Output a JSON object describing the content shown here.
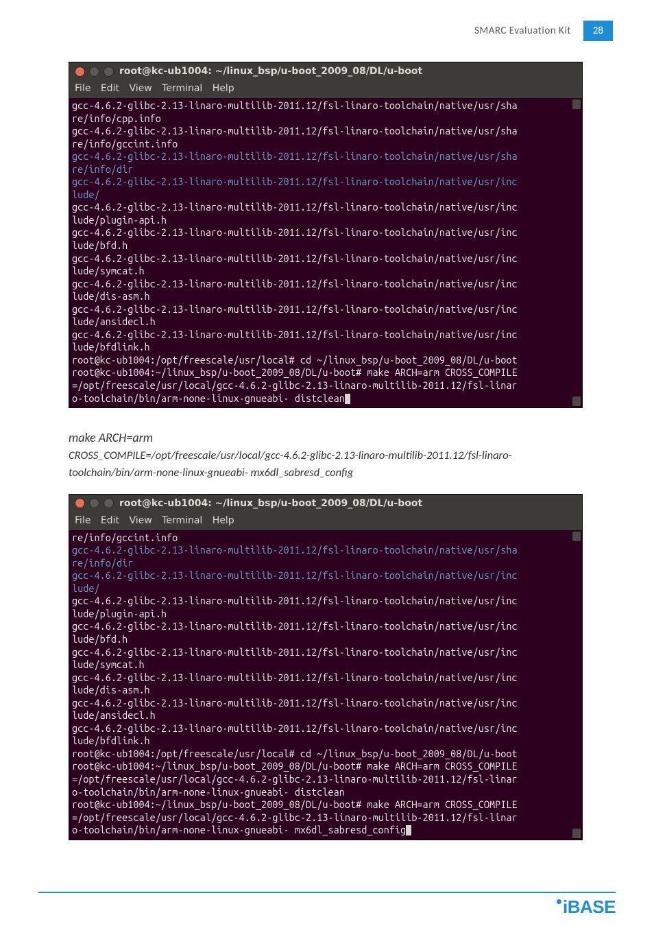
{
  "header": {
    "title": "SMARC Evaluation Kit",
    "page": "28"
  },
  "footer": {
    "logo": "iBASE"
  },
  "term_title": "root@kc-ub1004: ~/linux_bsp/u-boot_2009_08/DL/u-boot",
  "menubar": [
    "File",
    "Edit",
    "View",
    "Terminal",
    "Help"
  ],
  "term1": {
    "lines": [
      {
        "c": "w",
        "t": "gcc-4.6.2-glibc-2.13-linaro-multilib-2011.12/fsl-linaro-toolchain/native/usr/share/info/cpp.info"
      },
      {
        "c": "w",
        "t": "gcc-4.6.2-glibc-2.13-linaro-multilib-2011.12/fsl-linaro-toolchain/native/usr/share/info/gccint.info"
      },
      {
        "c": "b",
        "t": "gcc-4.6.2-glibc-2.13-linaro-multilib-2011.12/fsl-linaro-toolchain/native/usr/share/info/dir"
      },
      {
        "c": "b",
        "t": "gcc-4.6.2-glibc-2.13-linaro-multilib-2011.12/fsl-linaro-toolchain/native/usr/include/"
      },
      {
        "c": "w",
        "t": "gcc-4.6.2-glibc-2.13-linaro-multilib-2011.12/fsl-linaro-toolchain/native/usr/include/plugin-api.h"
      },
      {
        "c": "w",
        "t": "gcc-4.6.2-glibc-2.13-linaro-multilib-2011.12/fsl-linaro-toolchain/native/usr/include/bfd.h"
      },
      {
        "c": "w",
        "t": "gcc-4.6.2-glibc-2.13-linaro-multilib-2011.12/fsl-linaro-toolchain/native/usr/include/symcat.h"
      },
      {
        "c": "w",
        "t": "gcc-4.6.2-glibc-2.13-linaro-multilib-2011.12/fsl-linaro-toolchain/native/usr/include/dis-asm.h"
      },
      {
        "c": "w",
        "t": "gcc-4.6.2-glibc-2.13-linaro-multilib-2011.12/fsl-linaro-toolchain/native/usr/include/ansidecl.h"
      },
      {
        "c": "w",
        "t": "gcc-4.6.2-glibc-2.13-linaro-multilib-2011.12/fsl-linaro-toolchain/native/usr/include/bfdlink.h"
      },
      {
        "c": "w",
        "t": "root@kc-ub1004:/opt/freescale/usr/local# cd ~/linux_bsp/u-boot_2009_08/DL/u-boot"
      },
      {
        "c": "w",
        "t": "root@kc-ub1004:~/linux_bsp/u-boot_2009_08/DL/u-boot# make ARCH=arm CROSS_COMPILE=/opt/freescale/usr/local/gcc-4.6.2-glibc-2.13-linaro-multilib-2011.12/fsl-linaro-toolchain/bin/arm-none-linux-gnueabi- distclean"
      }
    ]
  },
  "body_text": {
    "lead": "make ARCH=arm",
    "rest": "CROSS_COMPILE=/opt/freescale/usr/local/gcc-4.6.2-glibc-2.13-linaro-multilib-2011.12/fsl-linaro-toolchain/bin/arm-none-linux-gnueabi- mx6dl_sabresd_config"
  },
  "term2": {
    "lines": [
      {
        "c": "w",
        "t": "re/info/gccint.info"
      },
      {
        "c": "b",
        "t": "gcc-4.6.2-glibc-2.13-linaro-multilib-2011.12/fsl-linaro-toolchain/native/usr/share/info/dir"
      },
      {
        "c": "b",
        "t": "gcc-4.6.2-glibc-2.13-linaro-multilib-2011.12/fsl-linaro-toolchain/native/usr/include/"
      },
      {
        "c": "w",
        "t": "gcc-4.6.2-glibc-2.13-linaro-multilib-2011.12/fsl-linaro-toolchain/native/usr/include/plugin-api.h"
      },
      {
        "c": "w",
        "t": "gcc-4.6.2-glibc-2.13-linaro-multilib-2011.12/fsl-linaro-toolchain/native/usr/include/bfd.h"
      },
      {
        "c": "w",
        "t": "gcc-4.6.2-glibc-2.13-linaro-multilib-2011.12/fsl-linaro-toolchain/native/usr/include/symcat.h"
      },
      {
        "c": "w",
        "t": "gcc-4.6.2-glibc-2.13-linaro-multilib-2011.12/fsl-linaro-toolchain/native/usr/include/dis-asm.h"
      },
      {
        "c": "w",
        "t": "gcc-4.6.2-glibc-2.13-linaro-multilib-2011.12/fsl-linaro-toolchain/native/usr/include/ansidecl.h"
      },
      {
        "c": "w",
        "t": "gcc-4.6.2-glibc-2.13-linaro-multilib-2011.12/fsl-linaro-toolchain/native/usr/include/bfdlink.h"
      },
      {
        "c": "w",
        "t": "root@kc-ub1004:/opt/freescale/usr/local# cd ~/linux_bsp/u-boot_2009_08/DL/u-boot"
      },
      {
        "c": "w",
        "t": "root@kc-ub1004:~/linux_bsp/u-boot_2009_08/DL/u-boot# make ARCH=arm CROSS_COMPILE=/opt/freescale/usr/local/gcc-4.6.2-glibc-2.13-linaro-multilib-2011.12/fsl-linaro-toolchain/bin/arm-none-linux-gnueabi- distclean"
      },
      {
        "c": "w",
        "t": "root@kc-ub1004:~/linux_bsp/u-boot_2009_08/DL/u-boot# make ARCH=arm CROSS_COMPILE=/opt/freescale/usr/local/gcc-4.6.2-glibc-2.13-linaro-multilib-2011.12/fsl-linaro-toolchain/bin/arm-none-linux-gnueabi- mx6dl_sabresd_config"
      }
    ]
  }
}
